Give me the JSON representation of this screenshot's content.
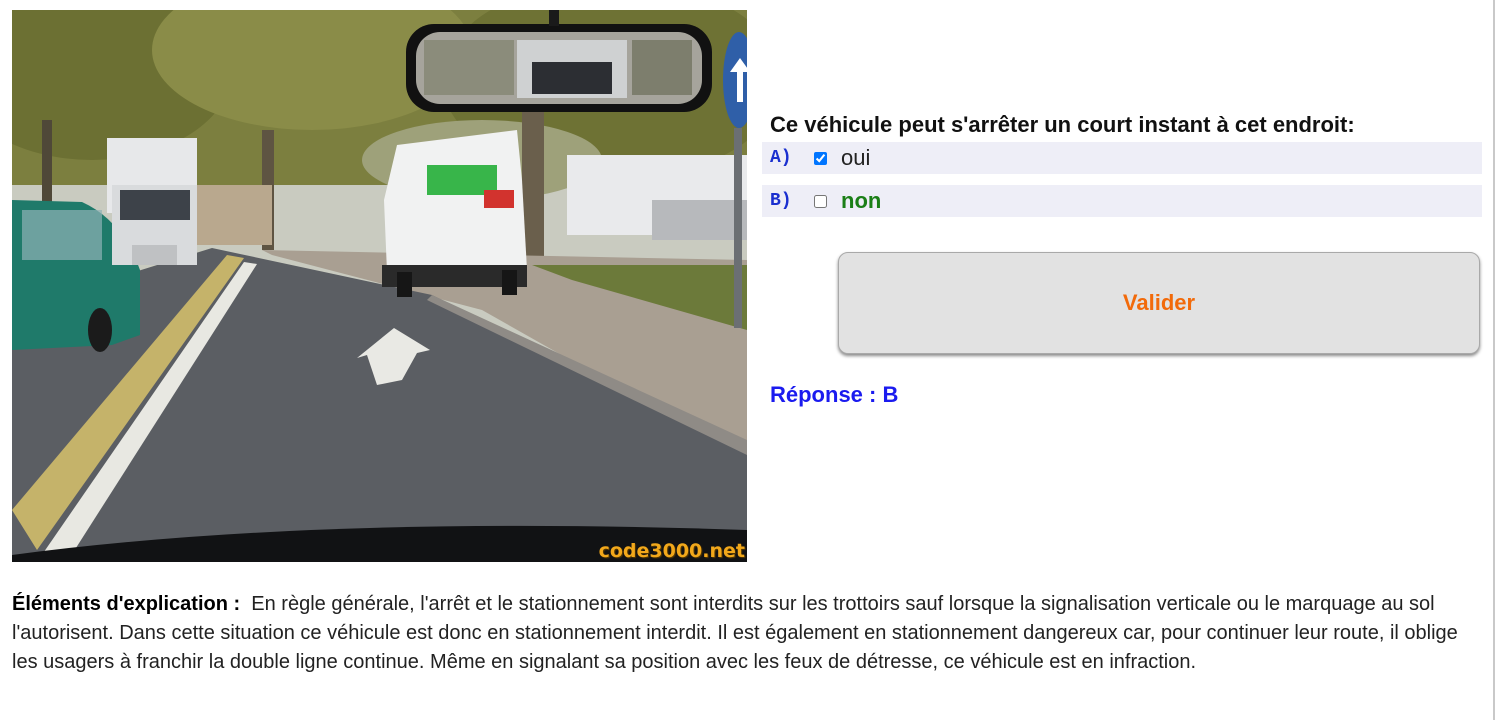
{
  "scene": {
    "watermark": "code3000.net"
  },
  "quiz": {
    "question": "Ce véhicule peut s'arrêter un court instant à cet endroit:",
    "answers": [
      {
        "letter": "A)",
        "text": "oui",
        "checked": true
      },
      {
        "letter": "B)",
        "text": "non",
        "checked": false
      }
    ],
    "validate_label": "Valider",
    "response": "Réponse : B"
  },
  "explanation": {
    "label": "Éléments d'explication :",
    "text": "En règle générale, l'arrêt et le stationnement sont interdits sur les trottoirs sauf lorsque la signalisation verticale ou le marquage au sol l'autorisent. Dans cette situation ce véhicule est donc en stationnement interdit. Il est également en stationnement dangereux car, pour continuer leur route, il oblige les usagers à franchir la double ligne continue. Même en signalant sa position avec les feux de détresse, ce véhicule est en infraction."
  },
  "colors": {
    "letter": "#1a2fcf",
    "correct_answer": "#1b7f17",
    "validate_text": "#f26a0a",
    "response": "#1b1bef",
    "row_background": "#eeeef7"
  }
}
